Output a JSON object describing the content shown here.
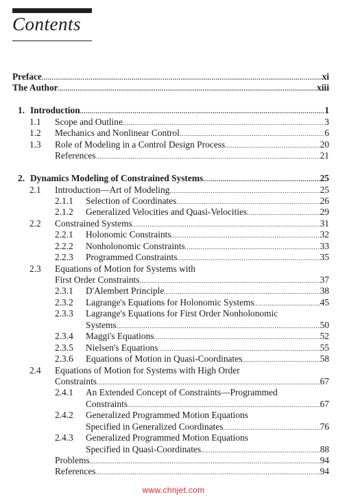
{
  "heading": "Contents",
  "entries": [
    {
      "level": 0,
      "title": "Preface",
      "page": "xi",
      "bold": true
    },
    {
      "level": 0,
      "title": "The Author",
      "page": "xiii",
      "bold": true
    },
    {
      "gap": true
    },
    {
      "level": 1,
      "num": "1.",
      "title": "Introduction",
      "page": "1",
      "bold": true
    },
    {
      "level": 2,
      "num": "1.1",
      "title": "Scope and Outline",
      "page": "3"
    },
    {
      "level": 2,
      "num": "1.2",
      "title": "Mechanics and Nonlinear Control",
      "page": "6"
    },
    {
      "level": 2,
      "num": "1.3",
      "title": "Role of Modeling in a Control Design Process",
      "page": "20"
    },
    {
      "level": 2,
      "title": "References",
      "page": "21"
    },
    {
      "gap": true
    },
    {
      "level": 1,
      "num": "2.",
      "title": "Dynamics Modeling of Constrained Systems",
      "page": "25",
      "bold": true
    },
    {
      "level": 2,
      "num": "2.1",
      "title": "Introduction—Art of Modeling",
      "page": "25"
    },
    {
      "level": 3,
      "num": "2.1.1",
      "title": "Selection of Coordinates",
      "page": "26"
    },
    {
      "level": 3,
      "num": "2.1.2",
      "title": "Generalized Velocities and Quasi-Velocities",
      "page": "29"
    },
    {
      "level": 2,
      "num": "2.2",
      "title": "Constrained Systems",
      "page": "31"
    },
    {
      "level": 3,
      "num": "2.2.1",
      "title": "Holonomic Constraints",
      "page": "32"
    },
    {
      "level": 3,
      "num": "2.2.2",
      "title": "Nonholonomic Constraints",
      "page": "33"
    },
    {
      "level": 3,
      "num": "2.2.3",
      "title": "Programmed Constraints",
      "page": "35"
    },
    {
      "level": 2,
      "num": "2.3",
      "title": "Equations of Motion for Systems with",
      "title_cont": "First Order Constraints",
      "page": "37"
    },
    {
      "level": 3,
      "num": "2.3.1",
      "title": "D'Alembert Principle",
      "page": "38"
    },
    {
      "level": 3,
      "num": "2.3.2",
      "title": "Lagrange's Equations for Holonomic Systems",
      "page": "45"
    },
    {
      "level": 3,
      "num": "2.3.3",
      "title": "Lagrange's Equations for First Order Nonholonomic",
      "title_cont": "Systems",
      "page": "50"
    },
    {
      "level": 3,
      "num": "2.3.4",
      "title": "Maggi's Equations",
      "page": "52"
    },
    {
      "level": 3,
      "num": "2.3.5",
      "title": "Nielsen's Equations",
      "page": "55"
    },
    {
      "level": 3,
      "num": "2.3.6",
      "title": "Equations of Motion in Quasi-Coordinates",
      "page": "58"
    },
    {
      "level": 2,
      "num": "2.4",
      "title": "Equations of Motion for Systems with High Order",
      "title_cont": "Constraints",
      "page": "67"
    },
    {
      "level": 3,
      "num": "2.4.1",
      "title": "An Extended Concept of Constraints—Programmed",
      "title_cont": "Constraints",
      "page": "67"
    },
    {
      "level": 3,
      "num": "2.4.2",
      "title": "Generalized Programmed Motion Equations",
      "title_cont": "Specified in Generalized Coordinates",
      "page": "76"
    },
    {
      "level": 3,
      "num": "2.4.3",
      "title": "Generalized Programmed Motion Equations",
      "title_cont": "Specified in Quasi-Coordinates",
      "page": "88"
    },
    {
      "level": 2,
      "title": "Problems",
      "page": "94"
    },
    {
      "level": 2,
      "title": "References",
      "page": "94"
    }
  ],
  "watermark": "www.chnjet.com",
  "colors": {
    "text": "#1a1a1a",
    "watermark": "#e8232a"
  }
}
